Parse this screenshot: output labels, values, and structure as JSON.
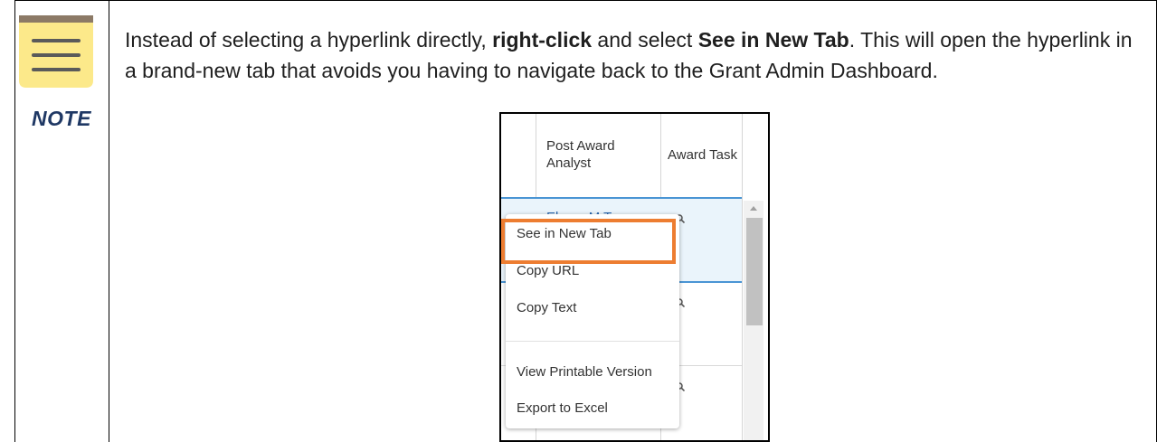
{
  "note": {
    "label": "NOTE"
  },
  "instruction": {
    "intro": "Instead of selecting a hyperlink directly, ",
    "action_bold": "right-click",
    "middle": " and select ",
    "target_bold": "See in New Tab",
    "outro": ". This will open the hyperlink in a brand-new tab that avoids you having to navigate back to the Grant Admin Dashboard."
  },
  "screenshot": {
    "columns": [
      {
        "header": "Post Award Analyst"
      },
      {
        "header": "Award Task"
      }
    ],
    "partial_link": "Ebony M Turner",
    "context_menu": {
      "items": [
        "See in New Tab",
        "Copy URL",
        "Copy Text",
        "View Printable Version",
        "Export to Excel"
      ]
    }
  },
  "colors": {
    "note_header": "#8c7a66",
    "note_body": "#fce98a",
    "note_lines": "#5a5a5a",
    "highlight": "#ed7d31",
    "link": "#2a68b0",
    "row_border": "#4a95d4"
  }
}
